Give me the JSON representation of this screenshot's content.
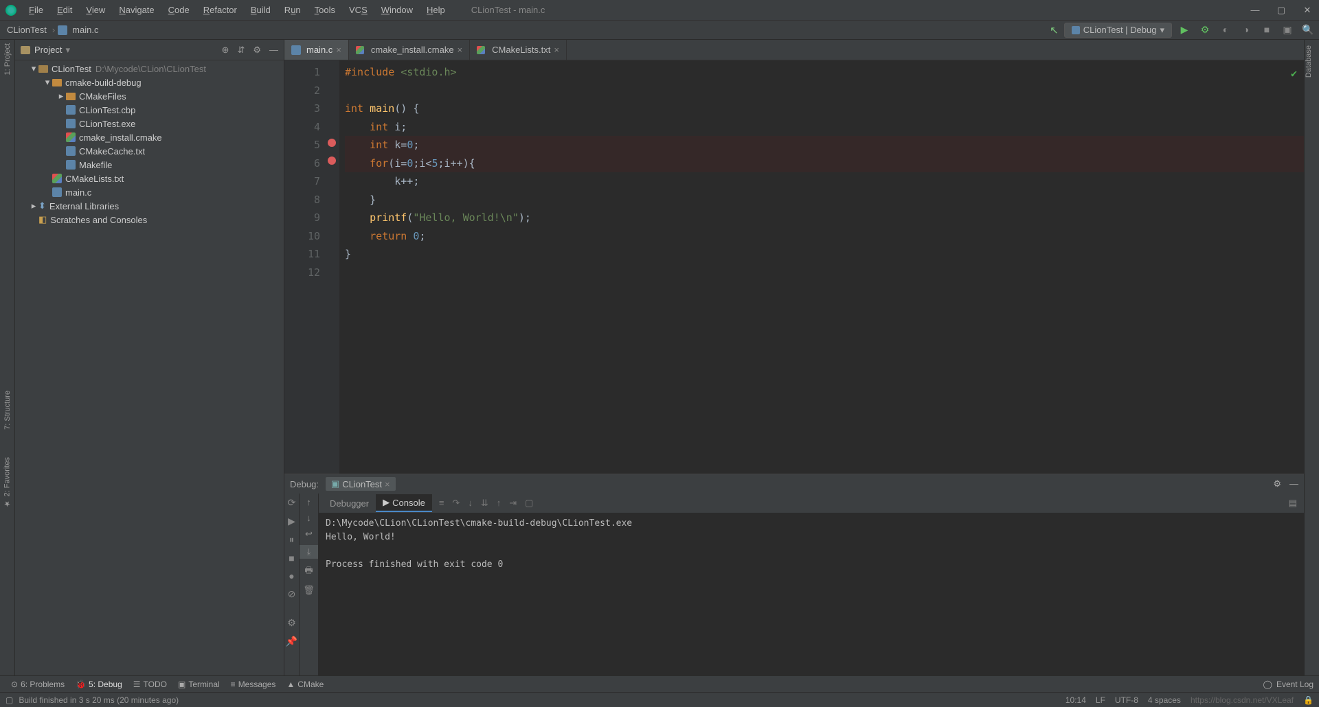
{
  "titlebar": {
    "title": "CLionTest - main.c"
  },
  "menubar": [
    "File",
    "Edit",
    "View",
    "Navigate",
    "Code",
    "Refactor",
    "Build",
    "Run",
    "Tools",
    "VCS",
    "Window",
    "Help"
  ],
  "breadcrumb": {
    "project": "CLionTest",
    "file": "main.c"
  },
  "build": {
    "config": "CLionTest | Debug"
  },
  "projectPane": {
    "title": "Project",
    "root": {
      "name": "CLionTest",
      "path": "D:\\Mycode\\CLion\\CLionTest"
    },
    "cmakeDir": "cmake-build-debug",
    "cmakeFilesDir": "CMakeFiles",
    "files": {
      "cbp": "CLionTest.cbp",
      "exe": "CLionTest.exe",
      "cmakeinstall": "cmake_install.cmake",
      "cmakecache": "CMakeCache.txt",
      "makefile": "Makefile",
      "cmakelists": "CMakeLists.txt",
      "mainc": "main.c"
    },
    "extlib": "External Libraries",
    "scratches": "Scratches and Consoles"
  },
  "tabs": [
    {
      "label": "main.c",
      "active": true
    },
    {
      "label": "cmake_install.cmake",
      "active": false
    },
    {
      "label": "CMakeLists.txt",
      "active": false
    }
  ],
  "code": {
    "lines": [
      {
        "n": 1
      },
      {
        "n": 2
      },
      {
        "n": 3
      },
      {
        "n": 4
      },
      {
        "n": 5,
        "bp": true
      },
      {
        "n": 6,
        "bp": true
      },
      {
        "n": 7
      },
      {
        "n": 8
      },
      {
        "n": 9
      },
      {
        "n": 10
      },
      {
        "n": 11
      },
      {
        "n": 12
      }
    ],
    "tokens": {
      "include": "#include",
      "stdio": "<stdio.h>",
      "int": "int",
      "main": "main",
      "paren_open": "() {",
      "int_i": "int",
      "i_semi": " i;",
      "int_k": "int",
      "k_eq": " k=",
      "zero": "0",
      "semi": ";",
      "for": "for",
      "for_body": "(i=",
      "zero2": "0",
      "mid": ";i<",
      "five": "5",
      "after": ";i++){",
      "kpp": "k++;",
      "brace_close": "}",
      "printf": "printf",
      "printf_open": "(",
      "hello": "\"Hello, World!\\n\"",
      "printf_close": ");",
      "return": "return",
      "zero3": " 0",
      "ret_semi": ";",
      "final_brace": "}"
    }
  },
  "debug": {
    "title": "Debug:",
    "tab": "CLionTest",
    "subtabs": {
      "debugger": "Debugger",
      "console": "Console"
    },
    "output": {
      "l1": "D:\\Mycode\\CLion\\CLionTest\\cmake-build-debug\\CLionTest.exe",
      "l2": "Hello, World!",
      "l3": "",
      "l4": "Process finished with exit code 0"
    }
  },
  "sideTabs": {
    "project": "1: Project",
    "structure": "7: Structure",
    "favorites": "2: Favorites",
    "database": "Database"
  },
  "bottombar": {
    "problems": "6: Problems",
    "debug": "5: Debug",
    "todo": "TODO",
    "terminal": "Terminal",
    "messages": "Messages",
    "cmake": "CMake",
    "eventlog": "Event Log"
  },
  "status": {
    "msg": "Build finished in 3 s 20 ms (20 minutes ago)",
    "time": "10:14",
    "le": "LF",
    "enc": "UTF-8",
    "indent": "4 spaces",
    "watermark": "https://blog.csdn.net/VXLeaf"
  }
}
